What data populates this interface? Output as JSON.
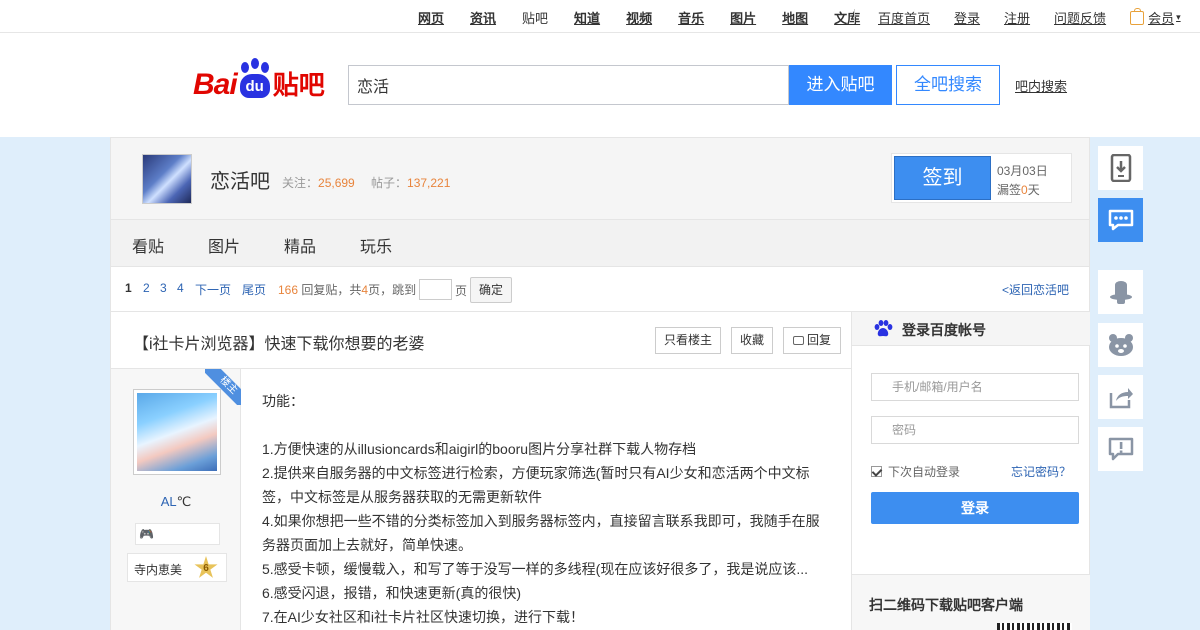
{
  "topnav": {
    "links": [
      "网页",
      "资讯",
      "贴吧",
      "知道",
      "视频",
      "音乐",
      "图片",
      "地图",
      "文库"
    ],
    "right": [
      "百度首页",
      "登录",
      "注册",
      "问题反馈"
    ],
    "vip": "会员"
  },
  "header": {
    "logo_bai": "Bai",
    "logo_du": "du",
    "logo_tieba": "贴吧",
    "search_value": "恋活",
    "enter_button": "进入贴吧",
    "all_search_button": "全吧搜索",
    "inbar_search": "吧内搜索"
  },
  "forum": {
    "name": "恋活吧",
    "follow_label": "关注：",
    "follow_count": "25,699",
    "posts_label": "帖子：",
    "posts_count": "137,221",
    "sign_button": "签到",
    "sign_date": "03月03日",
    "miss_prefix": "漏签",
    "miss_count": "0",
    "miss_suffix": "天"
  },
  "tabs": [
    "看贴",
    "图片",
    "精品",
    "玩乐"
  ],
  "pager": {
    "pages": [
      "1",
      "2",
      "3",
      "4",
      "下一页",
      "尾页"
    ],
    "reply_count": "166",
    "reply_label": "回复贴，共",
    "total_pages": "4",
    "pages_label": "页，跳到",
    "page_unit": "页",
    "ok_button": "确定",
    "back_link": "<返回恋活吧"
  },
  "post": {
    "title": "【i社卡片浏览器】快速下载你想要的老婆",
    "only_op": "只看楼主",
    "collect": "收藏",
    "reply": "回复",
    "op_badge": "楼主",
    "author": "AL",
    "author_suffix": "℃",
    "level_name": "寺内恵美",
    "level": "6",
    "lines": [
      "功能：",
      "",
      "1.方便快速的从illusioncards和aigirl的booru图片分享社群下载人物存档",
      "2.提供来自服务器的中文标签进行检索，方便玩家筛选(暂时只有AI少女和恋活两个中文标签，中文标签是从服务器获取的无需更新软件",
      "4.如果你想把一些不错的分类标签加入到服务器标签内，直接留言联系我即可，我随手在服务器页面加上去就好，简单快速。",
      "5.感受卡顿，缓慢载入，和写了等于没写一样的多线程(现在应该好很多了，我是说应该...",
      "6.感受闪退，报错，和快速更新(真的很快)",
      "7.在AI少女社区和i社卡片社区快速切换，进行下载！"
    ]
  },
  "login": {
    "title": "登录百度帐号",
    "username_placeholder": "手机/邮箱/用户名",
    "password_placeholder": "密码",
    "remember": "下次自动登录",
    "forgot": "忘记密码？",
    "login_button": "登录",
    "qr_title": "扫二维码下载贴吧客户端"
  },
  "sidetools": [
    "download-icon",
    "message-icon",
    "hat-icon",
    "bear-icon",
    "share-icon",
    "report-icon"
  ],
  "colors": {
    "accent": "#3388ff",
    "brand_red": "#e10601",
    "brand_blue": "#2932e1",
    "highlight": "#e8843c",
    "page_bg": "#dfeefb"
  }
}
